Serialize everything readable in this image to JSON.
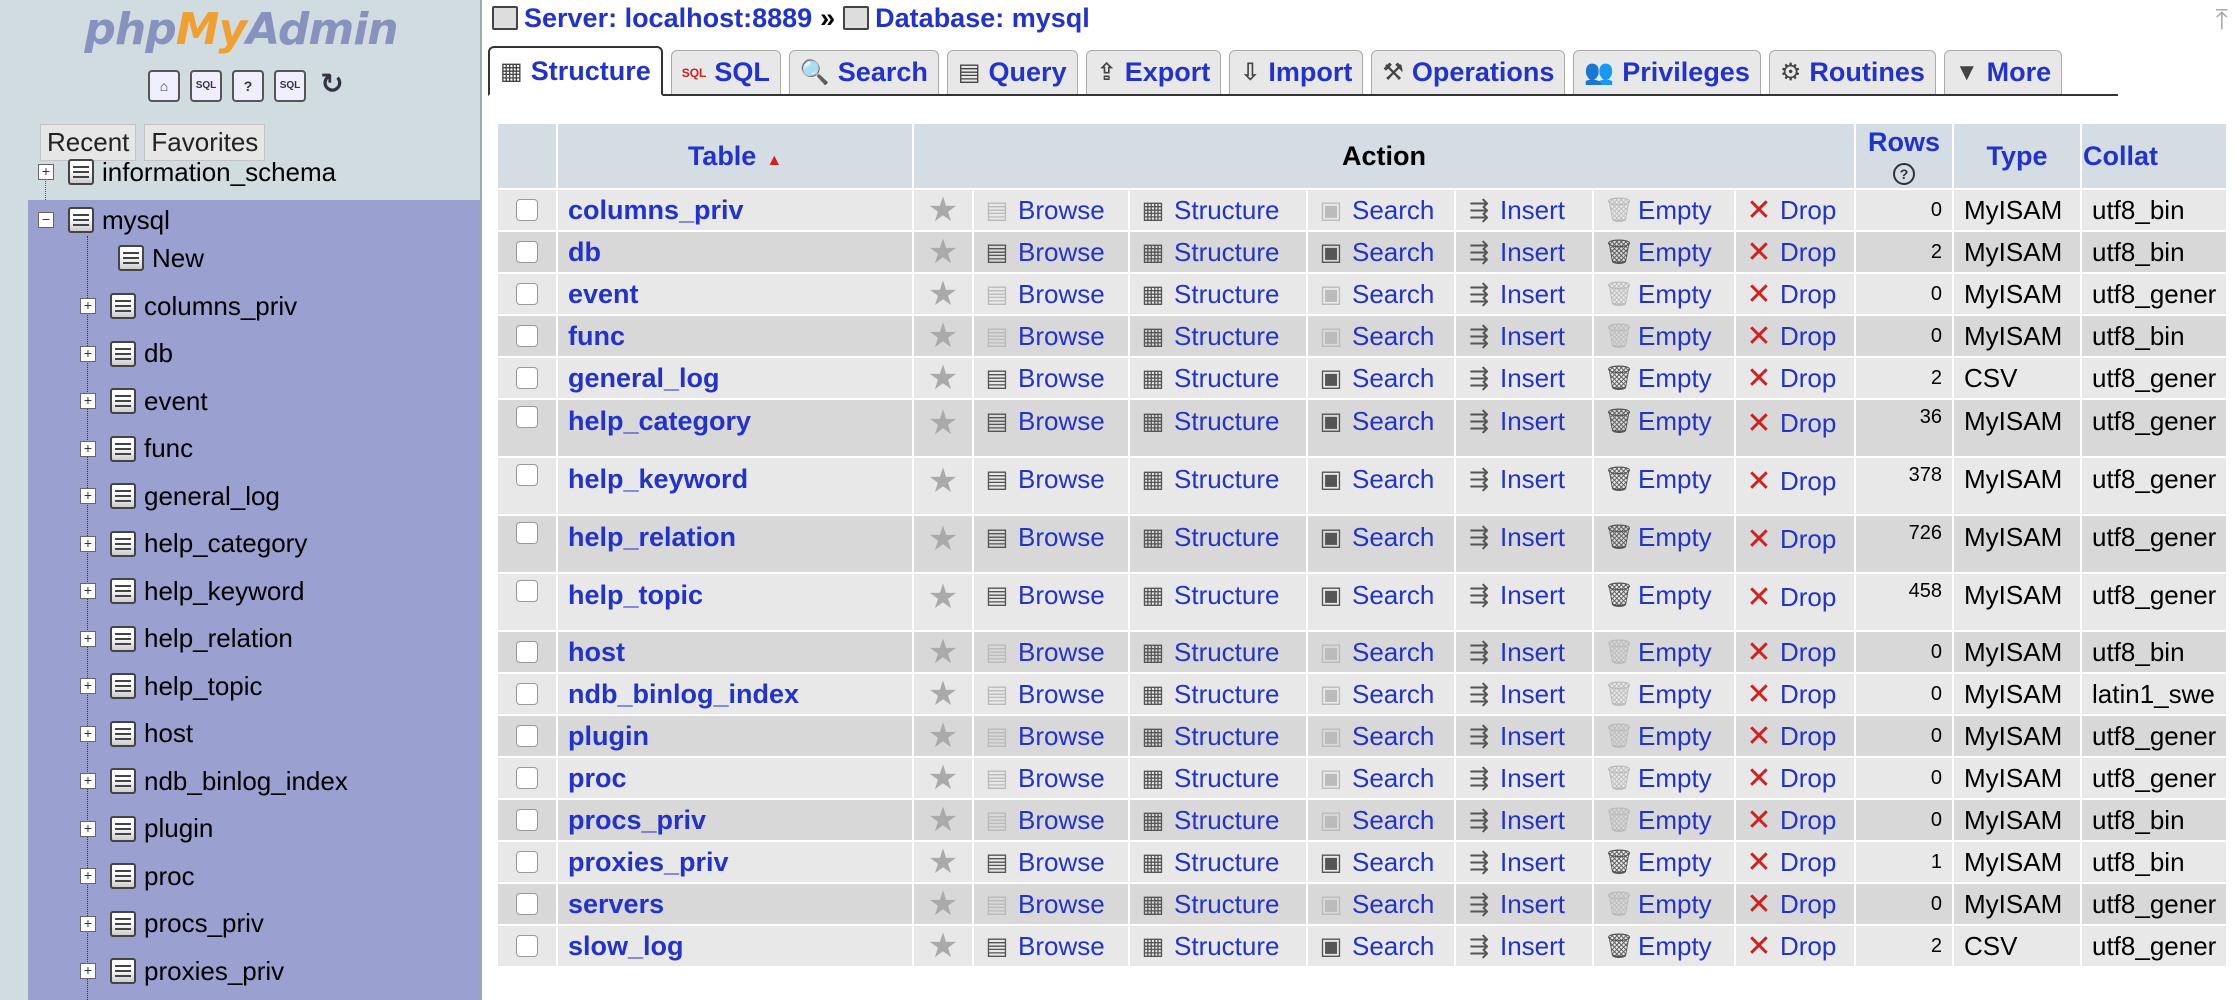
{
  "logo": {
    "php": "php",
    "my": "My",
    "admin": "Admin"
  },
  "nav_icons": [
    "home-icon",
    "sql-icon",
    "docs-icon",
    "sql-docs-icon",
    "reload-icon"
  ],
  "nav_icon_labels": {
    "home": "⌂",
    "sql": "SQL",
    "docs": "?",
    "sqldocs": "SQL",
    "reload": "↻"
  },
  "left_tabs": {
    "recent": "Recent",
    "favorites": "Favorites"
  },
  "tree": {
    "top_db": "information_schema",
    "current_db": "mysql",
    "new_label": "New",
    "tables": [
      "columns_priv",
      "db",
      "event",
      "func",
      "general_log",
      "help_category",
      "help_keyword",
      "help_relation",
      "help_topic",
      "host",
      "ndb_binlog_index",
      "plugin",
      "proc",
      "procs_priv",
      "proxies_priv"
    ]
  },
  "breadcrumb": {
    "server": "Server: localhost:8889",
    "sep": "»",
    "database": "Database: mysql"
  },
  "tabs": [
    {
      "label": "Structure",
      "icon": "structure-icon",
      "glyph": "▦",
      "active": true
    },
    {
      "label": "SQL",
      "icon": "sql-icon",
      "glyph": "SQL",
      "active": false
    },
    {
      "label": "Search",
      "icon": "search-icon",
      "glyph": "🔍",
      "active": false
    },
    {
      "label": "Query",
      "icon": "query-icon",
      "glyph": "▤",
      "active": false
    },
    {
      "label": "Export",
      "icon": "export-icon",
      "glyph": "⇪",
      "active": false
    },
    {
      "label": "Import",
      "icon": "import-icon",
      "glyph": "⇩",
      "active": false
    },
    {
      "label": "Operations",
      "icon": "operations-icon",
      "glyph": "⚒",
      "active": false
    },
    {
      "label": "Privileges",
      "icon": "privileges-icon",
      "glyph": "👥",
      "active": false
    },
    {
      "label": "Routines",
      "icon": "routines-icon",
      "glyph": "⚙",
      "active": false
    },
    {
      "label": "More",
      "icon": "more-icon",
      "glyph": "▼",
      "active": false
    }
  ],
  "table_headers": {
    "table": "Table",
    "action": "Action",
    "rows": "Rows",
    "type": "Type",
    "collation": "Collat"
  },
  "actions": {
    "browse": "Browse",
    "structure": "Structure",
    "search": "Search",
    "insert": "Insert",
    "empty": "Empty",
    "drop": "Drop"
  },
  "rows": [
    {
      "name": "columns_priv",
      "rows": "0",
      "type": "MyISAM",
      "collation": "utf8_bin",
      "tall": false
    },
    {
      "name": "db",
      "rows": "2",
      "type": "MyISAM",
      "collation": "utf8_bin",
      "tall": false
    },
    {
      "name": "event",
      "rows": "0",
      "type": "MyISAM",
      "collation": "utf8_gener",
      "tall": false
    },
    {
      "name": "func",
      "rows": "0",
      "type": "MyISAM",
      "collation": "utf8_bin",
      "tall": false
    },
    {
      "name": "general_log",
      "rows": "2",
      "type": "CSV",
      "collation": "utf8_gener",
      "tall": false
    },
    {
      "name": "help_category",
      "rows": "36",
      "type": "MyISAM",
      "collation": "utf8_gener",
      "tall": true
    },
    {
      "name": "help_keyword",
      "rows": "378",
      "type": "MyISAM",
      "collation": "utf8_gener",
      "tall": true
    },
    {
      "name": "help_relation",
      "rows": "726",
      "type": "MyISAM",
      "collation": "utf8_gener",
      "tall": true
    },
    {
      "name": "help_topic",
      "rows": "458",
      "type": "MyISAM",
      "collation": "utf8_gener",
      "tall": true
    },
    {
      "name": "host",
      "rows": "0",
      "type": "MyISAM",
      "collation": "utf8_bin",
      "tall": false
    },
    {
      "name": "ndb_binlog_index",
      "rows": "0",
      "type": "MyISAM",
      "collation": "latin1_swe",
      "tall": false
    },
    {
      "name": "plugin",
      "rows": "0",
      "type": "MyISAM",
      "collation": "utf8_gener",
      "tall": false
    },
    {
      "name": "proc",
      "rows": "0",
      "type": "MyISAM",
      "collation": "utf8_gener",
      "tall": false
    },
    {
      "name": "procs_priv",
      "rows": "0",
      "type": "MyISAM",
      "collation": "utf8_bin",
      "tall": false
    },
    {
      "name": "proxies_priv",
      "rows": "1",
      "type": "MyISAM",
      "collation": "utf8_bin",
      "tall": false
    },
    {
      "name": "servers",
      "rows": "0",
      "type": "MyISAM",
      "collation": "utf8_gener",
      "tall": false
    },
    {
      "name": "slow_log",
      "rows": "2",
      "type": "CSV",
      "collation": "utf8_gener",
      "tall": false
    }
  ],
  "colors": {
    "link": "#2233cc",
    "nav_bg": "#d0dce0",
    "nav_selected": "#9aa0cf",
    "drop": "#d02020"
  }
}
